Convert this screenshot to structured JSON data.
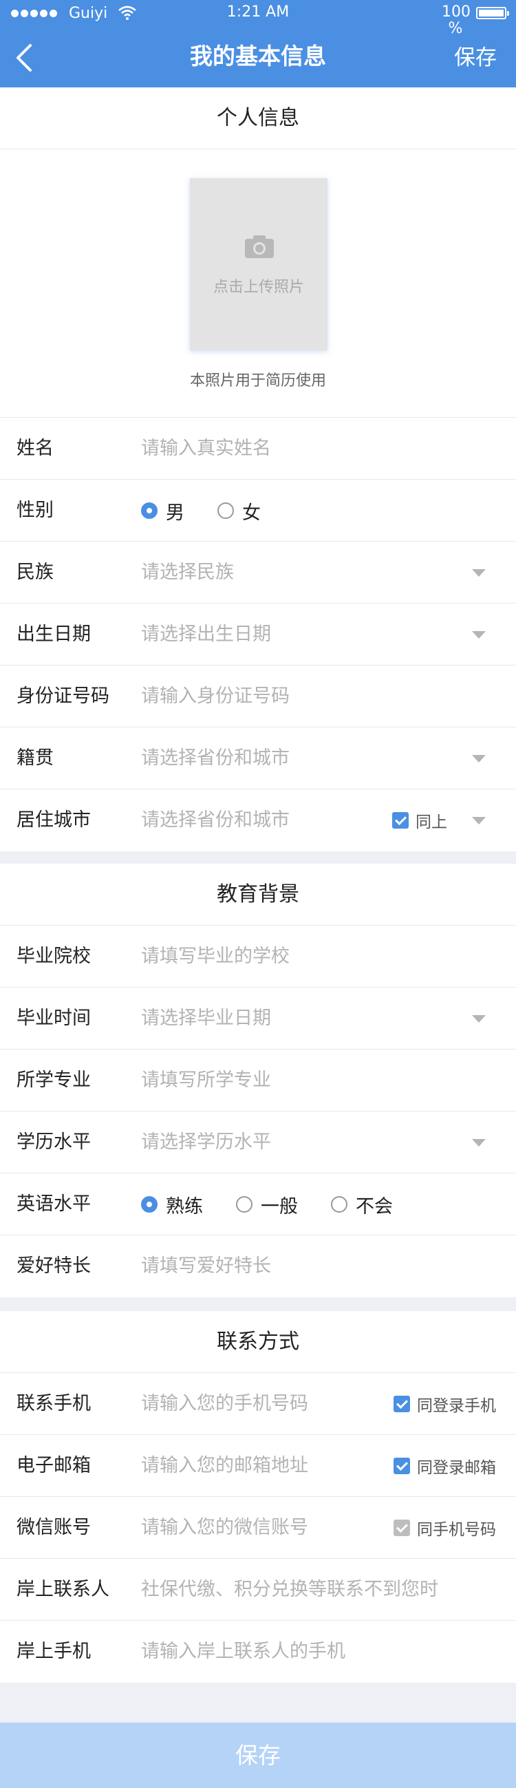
{
  "status_bar": {
    "carrier": "Guiyi",
    "time": "1:21 AM",
    "battery": "100 %"
  },
  "nav": {
    "title": "我的基本信息",
    "save": "保存"
  },
  "personal": {
    "header": "个人信息",
    "photo_prompt": "点击上传照片",
    "photo_note": "本照片用于简历使用",
    "name": {
      "label": "姓名",
      "placeholder": "请输入真实姓名"
    },
    "gender": {
      "label": "性别",
      "options": [
        "男",
        "女"
      ],
      "selected": "男"
    },
    "ethnicity": {
      "label": "民族",
      "placeholder": "请选择民族"
    },
    "birthdate": {
      "label": "出生日期",
      "placeholder": "请选择出生日期"
    },
    "id_number": {
      "label": "身份证号码",
      "placeholder": "请输入身份证号码"
    },
    "hometown": {
      "label": "籍贯",
      "placeholder": "请选择省份和城市"
    },
    "residence": {
      "label": "居住城市",
      "placeholder": "请选择省份和城市",
      "same_as": "同上"
    }
  },
  "education": {
    "header": "教育背景",
    "school": {
      "label": "毕业院校",
      "placeholder": "请填写毕业的学校"
    },
    "grad_time": {
      "label": "毕业时间",
      "placeholder": "请选择毕业日期"
    },
    "major": {
      "label": "所学专业",
      "placeholder": "请填写所学专业"
    },
    "degree": {
      "label": "学历水平",
      "placeholder": "请选择学历水平"
    },
    "english": {
      "label": "英语水平",
      "options": [
        "熟练",
        "一般",
        "不会"
      ],
      "selected": "熟练"
    },
    "hobbies": {
      "label": "爱好特长",
      "placeholder": "请填写爱好特长"
    }
  },
  "contact": {
    "header": "联系方式",
    "phone": {
      "label": "联系手机",
      "placeholder": "请输入您的手机号码",
      "check": "同登录手机"
    },
    "email": {
      "label": "电子邮箱",
      "placeholder": "请输入您的邮箱地址",
      "check": "同登录邮箱"
    },
    "wechat": {
      "label": "微信账号",
      "placeholder": "请输入您的微信账号",
      "check": "同手机号码"
    },
    "onshore_contact": {
      "label": "岸上联系人",
      "placeholder": "社保代缴、积分兑换等联系不到您时"
    },
    "onshore_phone": {
      "label": "岸上手机",
      "placeholder": "请输入岸上联系人的手机"
    }
  },
  "footer": {
    "save": "保存"
  },
  "colors": {
    "primary": "#4a8fe2",
    "save_disabled": "#b4d3f7",
    "background": "#eef0f5"
  }
}
